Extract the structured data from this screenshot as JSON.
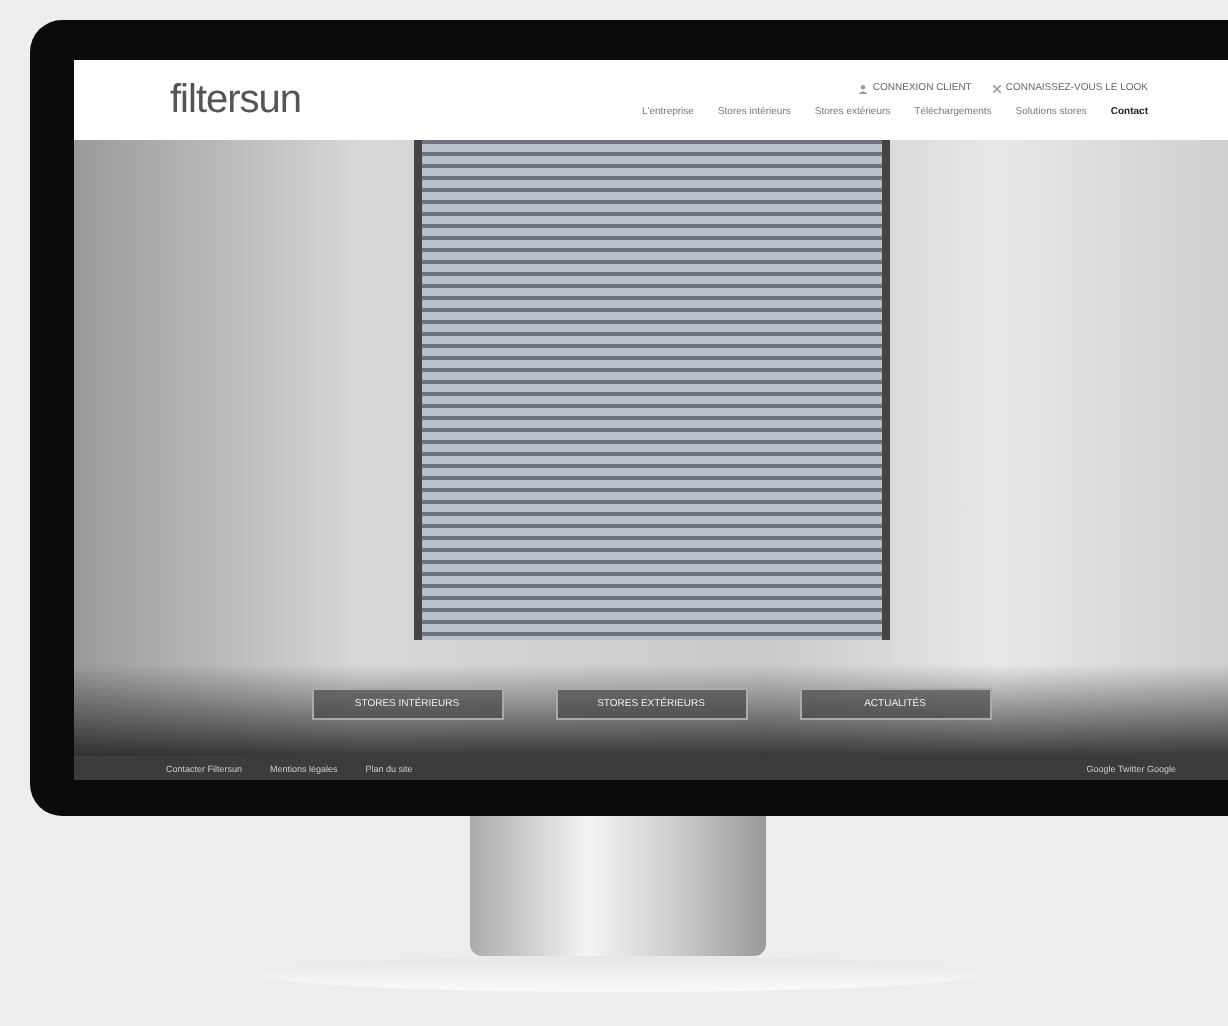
{
  "site": {
    "logo": "filtersun",
    "top_links": [
      "CONNEXION CLIENT",
      "CONNAISSEZ-VOUS LE LOOK"
    ],
    "nav": [
      {
        "label": "L'entreprise",
        "selected": false
      },
      {
        "label": "Stores intérieurs",
        "selected": false
      },
      {
        "label": "Stores extérieurs",
        "selected": false
      },
      {
        "label": "Téléchargements",
        "selected": false
      },
      {
        "label": "Solutions stores",
        "selected": false
      },
      {
        "label": "Contact",
        "selected": true
      }
    ],
    "hero_buttons": [
      "STORES INTÉRIEURS",
      "STORES EXTÉRIEURS",
      "ACTUALITÉS"
    ],
    "footer_links": [
      "Contacter Filtersun",
      "Mentions légales",
      "Plan du site"
    ],
    "footer_right": "Google Twitter Google"
  }
}
